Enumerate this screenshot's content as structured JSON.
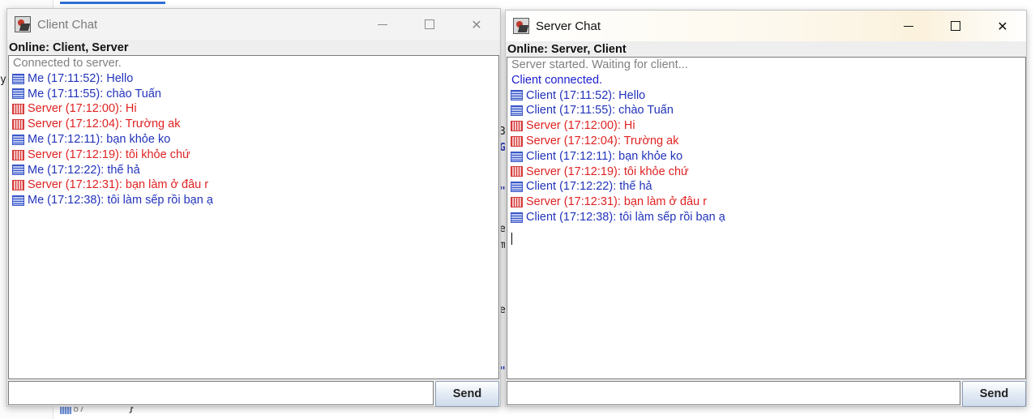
{
  "background": {
    "fragments": [
      "y",
      "3",
      "G",
      "\"",
      "e",
      "m",
      "e",
      "\""
    ],
    "line_number": "87",
    "brace": "}"
  },
  "colors": {
    "system_gray": "#808080",
    "system_blue": "#1c1cd0",
    "self_blue": "#2233bb",
    "remote_red": "#e02222"
  },
  "client_window": {
    "title": "Client Chat",
    "online": "Online: Client, Server",
    "window_controls": [
      "minimize-icon",
      "maximize-icon",
      "close-icon"
    ],
    "close_glyph": "✕",
    "messages": [
      {
        "type": "system",
        "color": "gray",
        "text": "Connected to server."
      },
      {
        "type": "message",
        "icon": "blue",
        "color": "blue",
        "text": "Me (17:11:52): Hello"
      },
      {
        "type": "message",
        "icon": "blue",
        "color": "blue",
        "text": "Me (17:11:55): chào Tuấn"
      },
      {
        "type": "message",
        "icon": "red",
        "color": "red",
        "text": "Server (17:12:00): Hi"
      },
      {
        "type": "message",
        "icon": "red",
        "color": "red",
        "text": "Server (17:12:04): Trường ak"
      },
      {
        "type": "message",
        "icon": "blue",
        "color": "blue",
        "text": "Me (17:12:11): bạn khỏe ko"
      },
      {
        "type": "message",
        "icon": "red",
        "color": "red",
        "text": "Server (17:12:19): tôi khỏe chứ"
      },
      {
        "type": "message",
        "icon": "blue",
        "color": "blue",
        "text": "Me (17:12:22): thế hả"
      },
      {
        "type": "message",
        "icon": "red",
        "color": "red",
        "text": "Server (17:12:31): bạn làm ở đâu r"
      },
      {
        "type": "message",
        "icon": "blue",
        "color": "blue",
        "text": "Me (17:12:38): tôi làm sếp rồi bạn ạ"
      }
    ],
    "input_value": "",
    "send_label": "Send"
  },
  "server_window": {
    "title": "Server Chat",
    "online": "Online: Server, Client",
    "window_controls": [
      "minimize-icon",
      "maximize-icon",
      "close-icon"
    ],
    "close_glyph": "✕",
    "messages": [
      {
        "type": "system",
        "color": "gray",
        "text": "Server started. Waiting for client..."
      },
      {
        "type": "system",
        "color": "sysblue",
        "text": "Client connected."
      },
      {
        "type": "message",
        "icon": "blue",
        "color": "blue",
        "text": "Client (17:11:52): Hello"
      },
      {
        "type": "message",
        "icon": "blue",
        "color": "blue",
        "text": "Client (17:11:55): chào Tuấn"
      },
      {
        "type": "message",
        "icon": "red",
        "color": "red",
        "text": "Server (17:12:00): Hi"
      },
      {
        "type": "message",
        "icon": "red",
        "color": "red",
        "text": "Server (17:12:04): Trường ak"
      },
      {
        "type": "message",
        "icon": "blue",
        "color": "blue",
        "text": "Client (17:12:11): bạn khỏe ko"
      },
      {
        "type": "message",
        "icon": "red",
        "color": "red",
        "text": "Server (17:12:19): tôi khỏe chứ"
      },
      {
        "type": "message",
        "icon": "blue",
        "color": "blue",
        "text": "Client (17:12:22): thế hả"
      },
      {
        "type": "message",
        "icon": "red",
        "color": "red",
        "text": "Server (17:12:31): bạn làm ở đâu r"
      },
      {
        "type": "message",
        "icon": "blue",
        "color": "blue",
        "text": "Client (17:12:38): tôi làm sếp rồi bạn ạ"
      }
    ],
    "input_value": "",
    "send_label": "Send"
  }
}
